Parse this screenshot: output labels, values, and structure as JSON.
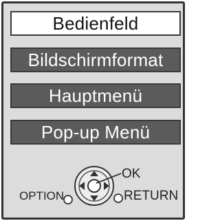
{
  "menu": {
    "items": [
      {
        "label": "Bedienfeld",
        "selected": true
      },
      {
        "label": "Bildschirmformat",
        "selected": false
      },
      {
        "label": "Hauptmenü",
        "selected": false
      },
      {
        "label": "Pop-up Menü",
        "selected": false
      }
    ]
  },
  "controls": {
    "ok_label": "OK",
    "option_label": "OPTION",
    "return_label": "RETURN"
  },
  "icons": [
    "dpad-icon",
    "option-button-icon",
    "return-button-icon"
  ],
  "colors": {
    "panel_bg": "#dcdcdc",
    "panel_border": "#333333",
    "item_selected_bg": "#ffffff",
    "item_normal_bg": "#5b5b5b",
    "item_normal_text": "#ffffff"
  }
}
